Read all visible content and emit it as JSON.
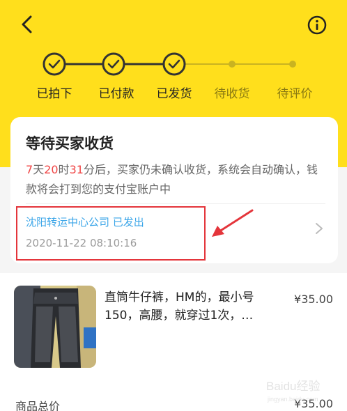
{
  "steps": [
    {
      "label": "已拍下",
      "state": "done"
    },
    {
      "label": "已付款",
      "state": "done"
    },
    {
      "label": "已发货",
      "state": "done"
    },
    {
      "label": "待收货",
      "state": "pending"
    },
    {
      "label": "待评价",
      "state": "pending"
    }
  ],
  "status_card": {
    "title": "等待买家收货",
    "countdown": {
      "days": "7",
      "days_unit": "天",
      "hours": "20",
      "hours_unit": "时",
      "minutes": "31",
      "minutes_unit": "分后，",
      "message": "买家仍未确认收货，系统会自动确认，钱款将会打到您的支付宝账户中"
    },
    "logistics": {
      "status": "沈阳转运中心公司 已发出",
      "time": "2020-11-22 08:10:16"
    }
  },
  "product": {
    "title": "直筒牛仔裤，HM的，最小号150，高腰，就穿过1次，…",
    "price": "¥35.00"
  },
  "totals": {
    "label": "商品总价",
    "value": "¥35.00"
  },
  "watermark": {
    "text": "Baidu经验",
    "sub": "jingyan.baidu.com"
  },
  "colors": {
    "header_bg": "#ffdf1c",
    "countdown_red": "#f04545",
    "logistics_blue": "#3aa5e8",
    "annotation_red": "#e4353b"
  },
  "icons": [
    "back-arrow-icon",
    "info-icon",
    "check-icon",
    "chevron-right-icon",
    "annotation-arrow-icon"
  ]
}
